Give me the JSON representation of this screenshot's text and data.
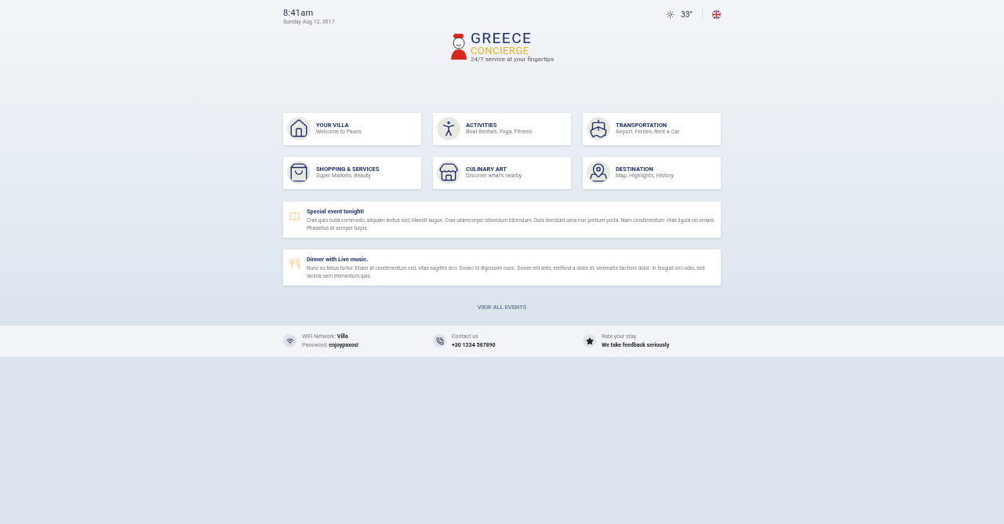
{
  "header": {
    "time": "8:41am",
    "date": "Sunday Aug 12, 2017",
    "temperature": "33°"
  },
  "logo": {
    "line1": "GREECE",
    "line2": "CONCIERGE",
    "tagline": "24/7 service at your fingertips"
  },
  "categories": [
    {
      "kind": "villa",
      "title": "YOUR VILLA",
      "subtitle": "Welcome to Paxos"
    },
    {
      "kind": "activities",
      "title": "ACTIVITIES",
      "subtitle": "Boat Rentals, Yoga, Fitness"
    },
    {
      "kind": "transportation",
      "title": "TRANSPORTATION",
      "subtitle": "Airport, Ferries, Rent a Car"
    },
    {
      "kind": "shopping",
      "title": "SHOPPING & SERVICES",
      "subtitle": "Super Markets, Beauty"
    },
    {
      "kind": "culinary",
      "title": "CULINARY ART",
      "subtitle": "Discover what's nearby"
    },
    {
      "kind": "destination",
      "title": "DESTINATION",
      "subtitle": "Map, Highlights, History"
    }
  ],
  "events": [
    {
      "kind": "ticket",
      "title": "Special event tonight!",
      "text": "Cras quis nulla commodo, aliquam lectus sed, blandit augue. Cras ullamcorper bibendum bibendum. Duis tincidunt urna non pretium porta. Nam condimentum vitae ligula vel ornare. Phasellus at semper turpis."
    },
    {
      "kind": "dining",
      "title": "Dinner with Live music.",
      "text": "Nunc eu tellus tortor. Etiam at condimentum nisl, vitae sagittis orci. Donec id dignissim nunc. Donec elit ante, eleifend a dolor et, venenatis facilisis dolor. In feugiat orci odio, sed lacinia sem elementum quis."
    }
  ],
  "view_all": "VIEW ALL EVENTS",
  "footer": [
    {
      "kind": "wifi",
      "line1": "WiFi Network: **Villa**",
      "line2": "Password: **enjoypaxos!**"
    },
    {
      "kind": "phone",
      "line1": "Contact us",
      "line2": "**+30 1234 567890**"
    },
    {
      "kind": "star",
      "line1": "Rate your stay",
      "line2": "**We take feedback seriously**"
    }
  ]
}
